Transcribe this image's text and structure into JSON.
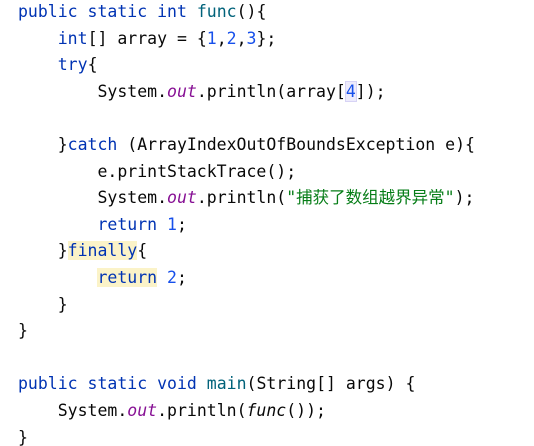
{
  "editor": {
    "lines": [
      [
        {
          "t": "public",
          "c": "kw"
        },
        {
          "t": " "
        },
        {
          "t": "static",
          "c": "kw"
        },
        {
          "t": " "
        },
        {
          "t": "int",
          "c": "kw"
        },
        {
          "t": " "
        },
        {
          "t": "func",
          "c": "fn"
        },
        {
          "t": "(){"
        }
      ],
      [
        {
          "t": "    "
        },
        {
          "t": "int",
          "c": "kw"
        },
        {
          "t": "[] array = {"
        },
        {
          "t": "1",
          "c": "num"
        },
        {
          "t": ","
        },
        {
          "t": "2",
          "c": "num"
        },
        {
          "t": ","
        },
        {
          "t": "3",
          "c": "num"
        },
        {
          "t": "};"
        }
      ],
      [
        {
          "t": "    "
        },
        {
          "t": "try",
          "c": "kw"
        },
        {
          "t": "{"
        }
      ],
      [
        {
          "t": "        System."
        },
        {
          "t": "out",
          "c": "field"
        },
        {
          "t": ".println(array["
        },
        {
          "t": "4",
          "c": "num hl-box"
        },
        {
          "t": "]);"
        }
      ],
      [],
      [
        {
          "t": "    }"
        },
        {
          "t": "catch",
          "c": "kw"
        },
        {
          "t": " (ArrayIndexOutOfBoundsException e){"
        }
      ],
      [
        {
          "t": "        e.printStackTrace();"
        }
      ],
      [
        {
          "t": "        System."
        },
        {
          "t": "out",
          "c": "field"
        },
        {
          "t": ".println("
        },
        {
          "t": "\"捕获了数组越界异常\"",
          "c": "str"
        },
        {
          "t": ");"
        }
      ],
      [
        {
          "t": "        "
        },
        {
          "t": "return",
          "c": "kw"
        },
        {
          "t": " "
        },
        {
          "t": "1",
          "c": "num"
        },
        {
          "t": ";"
        }
      ],
      [
        {
          "t": "    }"
        },
        {
          "t": "finally",
          "c": "kw hl"
        },
        {
          "t": "{"
        }
      ],
      [
        {
          "t": "        "
        },
        {
          "t": "return",
          "c": "kw hl"
        },
        {
          "t": " "
        },
        {
          "t": "2",
          "c": "num"
        },
        {
          "t": ";"
        }
      ],
      [
        {
          "t": "    }"
        }
      ],
      [
        {
          "t": "}"
        }
      ],
      [],
      [
        {
          "t": "public",
          "c": "kw"
        },
        {
          "t": " "
        },
        {
          "t": "static",
          "c": "kw"
        },
        {
          "t": " "
        },
        {
          "t": "void",
          "c": "kw"
        },
        {
          "t": " "
        },
        {
          "t": "main",
          "c": "fn"
        },
        {
          "t": "(String[] args) {"
        }
      ],
      [
        {
          "t": "    System."
        },
        {
          "t": "out",
          "c": "field"
        },
        {
          "t": ".println("
        },
        {
          "t": "func",
          "c": "call-italic"
        },
        {
          "t": "());"
        }
      ],
      [
        {
          "t": "}"
        }
      ]
    ]
  }
}
